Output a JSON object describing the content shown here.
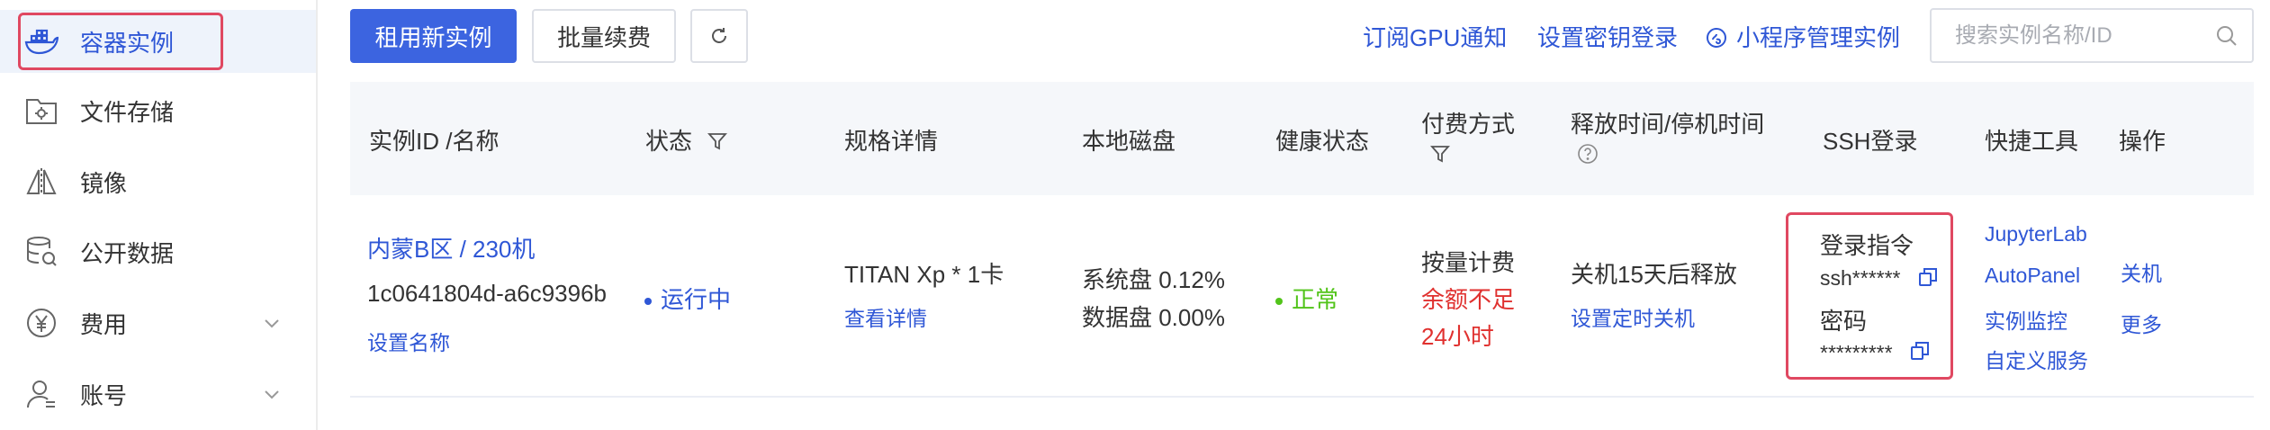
{
  "sidebar": {
    "items": [
      {
        "label": "容器实例",
        "icon": "docker-whale-icon",
        "active": true
      },
      {
        "label": "文件存储",
        "icon": "folder-gear-icon"
      },
      {
        "label": "镜像",
        "icon": "mirror-icon"
      },
      {
        "label": "公开数据",
        "icon": "database-icon"
      },
      {
        "label": "费用",
        "icon": "yen-icon",
        "expandable": true
      },
      {
        "label": "账号",
        "icon": "user-icon",
        "expandable": true
      }
    ]
  },
  "toolbar": {
    "rent_button": "租用新实例",
    "batch_renew_button": "批量续费",
    "refresh_icon": "refresh-icon",
    "links": {
      "subscribe_gpu": "订阅GPU通知",
      "set_key_login": "设置密钥登录",
      "mini_program": "小程序管理实例"
    },
    "search_placeholder": "搜索实例名称/ID"
  },
  "table": {
    "headers": {
      "id_name": "实例ID /名称",
      "status": "状态",
      "spec": "规格详情",
      "disk": "本地磁盘",
      "health": "健康状态",
      "billing_line1": "付费方式",
      "release": "释放时间/停机时间",
      "ssh": "SSH登录",
      "tools": "快捷工具",
      "ops": "操作"
    },
    "row": {
      "region_name": "内蒙B区 / 230机",
      "instance_id": "1c0641804d-a6c9396b",
      "set_name": "设置名称",
      "status": "运行中",
      "spec": "TITAN Xp * 1卡",
      "view_details": "查看详情",
      "system_disk": "系统盘 0.12%",
      "data_disk": "数据盘 0.00%",
      "health": "正常",
      "billing": "按量计费",
      "balance_warning_1": "余额不足",
      "balance_warning_2": "24小时",
      "release_info": "关机15天后释放",
      "set_timed_shutdown": "设置定时关机",
      "ssh_cmd_label": "登录指令",
      "ssh_cmd_value": "ssh******",
      "ssh_pwd_label": "密码",
      "ssh_pwd_value": "*********",
      "tools": [
        "JupyterLab",
        "AutoPanel",
        "实例监控",
        "自定义服务"
      ],
      "op_shutdown": "关机",
      "op_more": "更多"
    }
  },
  "colors": {
    "primary": "#3c64e0",
    "link": "#2f57d6",
    "highlight": "#e04861",
    "danger": "#e0312f",
    "success": "#52c41a"
  }
}
